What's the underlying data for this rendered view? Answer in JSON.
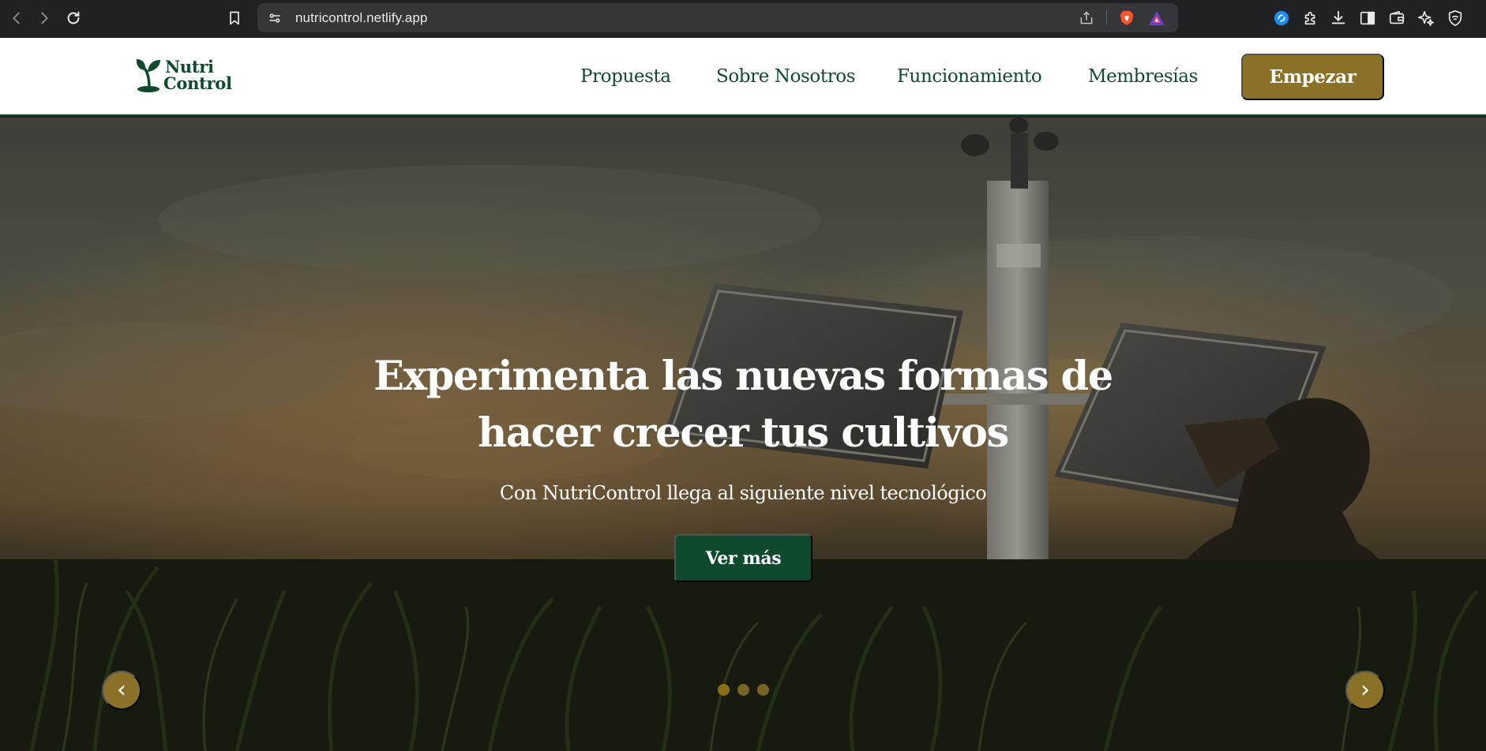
{
  "browser": {
    "url": "nutricontrol.netlify.app",
    "icons": [
      "back-icon",
      "forward-icon",
      "reload-icon",
      "bookmark-icon",
      "site-info-icon",
      "share-icon",
      "brave-shields-icon",
      "brave-rewards-icon",
      "extension-icon",
      "puzzle-icon",
      "download-icon",
      "sidebar-icon",
      "wallet-icon",
      "leo-ai-icon",
      "vpn-icon"
    ]
  },
  "header": {
    "logo_line1": "Nutri",
    "logo_line2": "Control",
    "nav": {
      "propuesta": "Propuesta",
      "sobre": "Sobre Nosotros",
      "funcionamiento": "Funcionamiento",
      "membresias": "Membresías"
    },
    "cta_label": "Empezar"
  },
  "hero": {
    "title": "Experimenta las nuevas formas de hacer crecer tus cultivos",
    "subtitle": "Con NutriControl llega al siguiente nivel tecnológico",
    "button_label": "Ver más",
    "prev_label": "‹",
    "next_label": "›",
    "active_slide": 1,
    "slide_count": 3
  },
  "colors": {
    "brand_green": "#0f4a2c",
    "brand_gold": "#8a7127",
    "chrome_bg": "#202124",
    "omnibox_bg": "#35363a"
  }
}
